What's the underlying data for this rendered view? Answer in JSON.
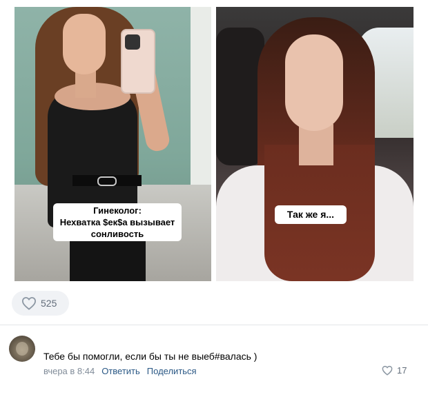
{
  "post": {
    "photos": [
      {
        "caption_lines": [
          "Гинеколог:",
          "Нехватка $ек$а вызывает",
          "сонливость"
        ]
      },
      {
        "caption_lines": [
          "Так же я..."
        ]
      }
    ],
    "likes": {
      "icon": "heart-outline-icon",
      "count": "525"
    }
  },
  "comment": {
    "avatar": "avatar",
    "text": "Тебе бы помогли, если бы ты не выеб#валась )",
    "time": "вчера в 8:44",
    "reply_label": "Ответить",
    "share_label": "Поделиться",
    "likes": {
      "icon": "heart-outline-icon",
      "count": "17"
    }
  },
  "colors": {
    "link": "#2a5885",
    "meta_gray": "#818c99",
    "pill_bg": "#f0f2f5",
    "count_gray": "#626d7a"
  }
}
